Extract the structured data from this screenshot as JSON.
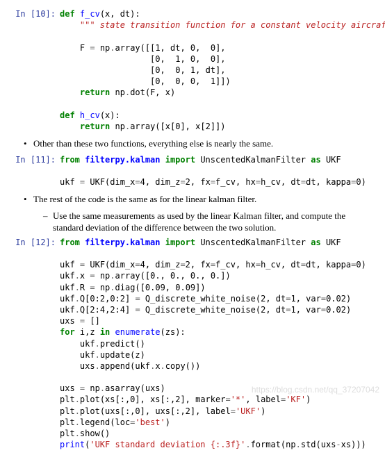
{
  "cells": {
    "c10": {
      "prompt": "In [10]:",
      "def1_kw": "def",
      "def1_name": "f_cv",
      "def1_args": "(x, dt):",
      "docstr": "\"\"\" state transition function for a constant velocity aircraft\"\"\"",
      "l1a": "F ",
      "l1b": "=",
      "l1c": " np",
      "l1d": ".",
      "l1e": "array([[",
      "l1f": "1",
      "l1g": ", dt, ",
      "l1h": "0",
      "l1i": ",  ",
      "l1j": "0",
      "l1k": "],",
      "l2a": "              [",
      "l2b": "0",
      "l2c": ",  ",
      "l2d": "1",
      "l2e": ", ",
      "l2f": "0",
      "l2g": ",  ",
      "l2h": "0",
      "l2i": "],",
      "l3a": "              [",
      "l3b": "0",
      "l3c": ",  ",
      "l3d": "0",
      "l3e": ", ",
      "l3f": "1",
      "l3g": ", dt],",
      "l4a": "              [",
      "l4b": "0",
      "l4c": ",  ",
      "l4d": "0",
      "l4e": ", ",
      "l4f": "0",
      "l4g": ",  ",
      "l4h": "1",
      "l4i": "]])",
      "ret1_kw": "return",
      "ret1_body": " np",
      "ret1_dot": ".",
      "ret1_tail": "dot(F, x)",
      "def2_kw": "def",
      "def2_name": "h_cv",
      "def2_args": "(x):",
      "ret2_kw": "return",
      "ret2_body": " np",
      "ret2_dot": ".",
      "ret2_tail": "array([x[",
      "ret2_n0": "0",
      "ret2_mid": "], x[",
      "ret2_n2": "2",
      "ret2_end": "]])"
    },
    "bullet1": "Other than these two functions, everything else is nearly the same.",
    "c11": {
      "prompt": "In [11]:",
      "imp_from": "from",
      "imp_mod": " filterpy.kalman ",
      "imp_imp": "import",
      "imp_cls": " UnscentedKalmanFilter ",
      "imp_as": "as",
      "imp_alias": " UKF",
      "l1a": "ukf ",
      "l1b": "=",
      "l1c": " UKF(dim_x",
      "l1d": "=",
      "l1e": "4",
      "l1f": ", dim_z",
      "l1g": "=",
      "l1h": "2",
      "l1i": ", fx",
      "l1j": "=",
      "l1k": "f_cv, hx",
      "l1l": "=",
      "l1m": "h_cv, dt",
      "l1n": "=",
      "l1o": "dt, kappa",
      "l1p": "=",
      "l1q": "0",
      "l1r": ")"
    },
    "bullet2": "The rest of the code is the same as for the linear kalman filter.",
    "bullet2sub": "Use the same measurements as used by the linear Kalman filter, and compute the standard deviation of the difference between the two solution.",
    "c12": {
      "prompt": "In [12]:",
      "imp_from": "from",
      "imp_mod": " filterpy.kalman ",
      "imp_imp": "import",
      "imp_cls": " UnscentedKalmanFilter ",
      "imp_as": "as",
      "imp_alias": " UKF",
      "u1a": "ukf ",
      "u1b": "=",
      "u1c": " UKF(dim_x",
      "u1d": "=",
      "u1e": "4",
      "u1f": ", dim_z",
      "u1g": "=",
      "u1h": "2",
      "u1i": ", fx",
      "u1j": "=",
      "u1k": "f_cv, hx",
      "u1l": "=",
      "u1m": "h_cv, dt",
      "u1n": "=",
      "u1o": "dt, kappa",
      "u1p": "=",
      "u1q": "0",
      "u1r": ")",
      "u2a": "ukf",
      "u2b": ".",
      "u2c": "x ",
      "u2d": "=",
      "u2e": " np",
      "u2f": ".",
      "u2g": "array([",
      "u2h": "0.",
      "u2i": ", ",
      "u2j": "0.",
      "u2k": ", ",
      "u2l": "0.",
      "u2m": ", ",
      "u2n": "0.",
      "u2o": "])",
      "u3a": "ukf",
      "u3b": ".",
      "u3c": "R ",
      "u3d": "=",
      "u3e": " np",
      "u3f": ".",
      "u3g": "diag([",
      "u3h": "0.09",
      "u3i": ", ",
      "u3j": "0.09",
      "u3k": "])",
      "u4a": "ukf",
      "u4b": ".",
      "u4c": "Q[",
      "u4d": "0",
      "u4e": ":",
      "u4f": "2",
      "u4g": ",",
      "u4h": "0",
      "u4i": ":",
      "u4j": "2",
      "u4k": "] ",
      "u4l": "=",
      "u4m": " Q_discrete_white_noise(",
      "u4n": "2",
      "u4o": ", dt",
      "u4p": "=",
      "u4q": "1",
      "u4r": ", var",
      "u4s": "=",
      "u4t": "0.02",
      "u4u": ")",
      "u5a": "ukf",
      "u5b": ".",
      "u5c": "Q[",
      "u5d": "2",
      "u5e": ":",
      "u5f": "4",
      "u5g": ",",
      "u5h": "2",
      "u5i": ":",
      "u5j": "4",
      "u5k": "] ",
      "u5l": "=",
      "u5m": " Q_discrete_white_noise(",
      "u5n": "2",
      "u5o": ", dt",
      "u5p": "=",
      "u5q": "1",
      "u5r": ", var",
      "u5s": "=",
      "u5t": "0.02",
      "u5u": ")",
      "u6a": "uxs ",
      "u6b": "=",
      "u6c": " []",
      "u7a": "for",
      "u7b": " i,z ",
      "u7c": "in",
      "u7d": " ",
      "u7e": "enumerate",
      "u7f": "(zs):",
      "u8a": "ukf",
      "u8b": ".",
      "u8c": "predict()",
      "u9a": "ukf",
      "u9b": ".",
      "u9c": "update(z)",
      "u10a": "uxs",
      "u10b": ".",
      "u10c": "append(ukf",
      "u10d": ".",
      "u10e": "x",
      "u10f": ".",
      "u10g": "copy())",
      "u11a": "uxs ",
      "u11b": "=",
      "u11c": " np",
      "u11d": ".",
      "u11e": "asarray(uxs)",
      "u12a": "plt",
      "u12b": ".",
      "u12c": "plot(xs[:,",
      "u12d": "0",
      "u12e": "], xs[:,",
      "u12f": "2",
      "u12g": "], marker",
      "u12h": "=",
      "u12i": "'*'",
      "u12j": ", label",
      "u12k": "=",
      "u12l": "'KF'",
      "u12m": ")",
      "u13a": "plt",
      "u13b": ".",
      "u13c": "plot(uxs[:,",
      "u13d": "0",
      "u13e": "], uxs[:,",
      "u13f": "2",
      "u13g": "], label",
      "u13h": "=",
      "u13i": "'UKF'",
      "u13j": ")",
      "u14a": "plt",
      "u14b": ".",
      "u14c": "legend(loc",
      "u14d": "=",
      "u14e": "'best'",
      "u14f": ")",
      "u15a": "plt",
      "u15b": ".",
      "u15c": "show()",
      "u16a": "print",
      "u16b": "(",
      "u16c": "'UKF standard deviation ",
      "u16d": "{:.3f}",
      "u16e": "'",
      "u16f": ".",
      "u16g": "format(np",
      "u16h": ".",
      "u16i": "std(uxs",
      "u16j": "-",
      "u16k": "xs)))"
    }
  },
  "watermark": "https://blog.csdn.net/qq_37207042"
}
